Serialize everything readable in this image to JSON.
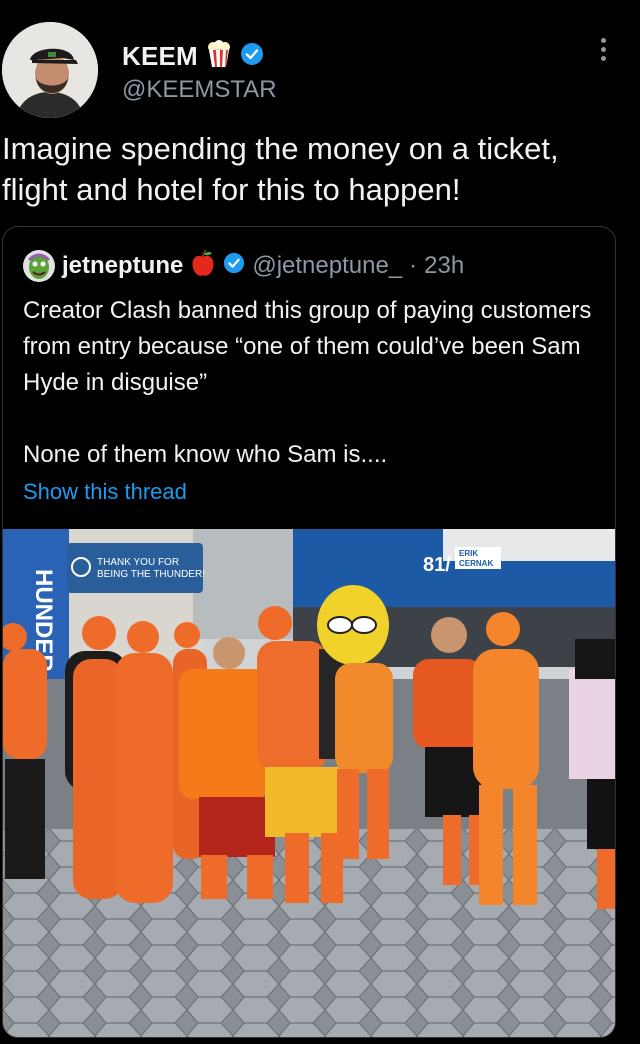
{
  "author": {
    "name": "KEEM",
    "handle": "@KEEMSTAR",
    "emoji": "popcorn-icon",
    "verified": true
  },
  "tweet": {
    "text": "Imagine spending the money on a ticket, flight and hotel for this to happen!"
  },
  "quoted": {
    "name": "jetneptune",
    "emoji": "apple-icon",
    "handle": "@jetneptune_",
    "separator": "·",
    "time": "23h",
    "text": "Creator Clash banned this group of paying customers from entry because “one of them could’ve been Sam Hyde in disguise”\n\nNone of them know who Sam is....",
    "show_thread": "Show this thread",
    "photo": {
      "sign_thank": "THANK YOU FOR",
      "sign_being": "BEING THE THUNDER!",
      "banner_vertical": "HUNDER",
      "banner_number": "81/",
      "banner_name_1": "ERIK",
      "banner_name_2": "CERNAK"
    }
  },
  "colors": {
    "background": "#000000",
    "text": "#e7e9ea",
    "muted": "#8b98a5",
    "link": "#1d9bf0",
    "verified": "#1d9bf0",
    "suit": "#ee6b2a"
  }
}
